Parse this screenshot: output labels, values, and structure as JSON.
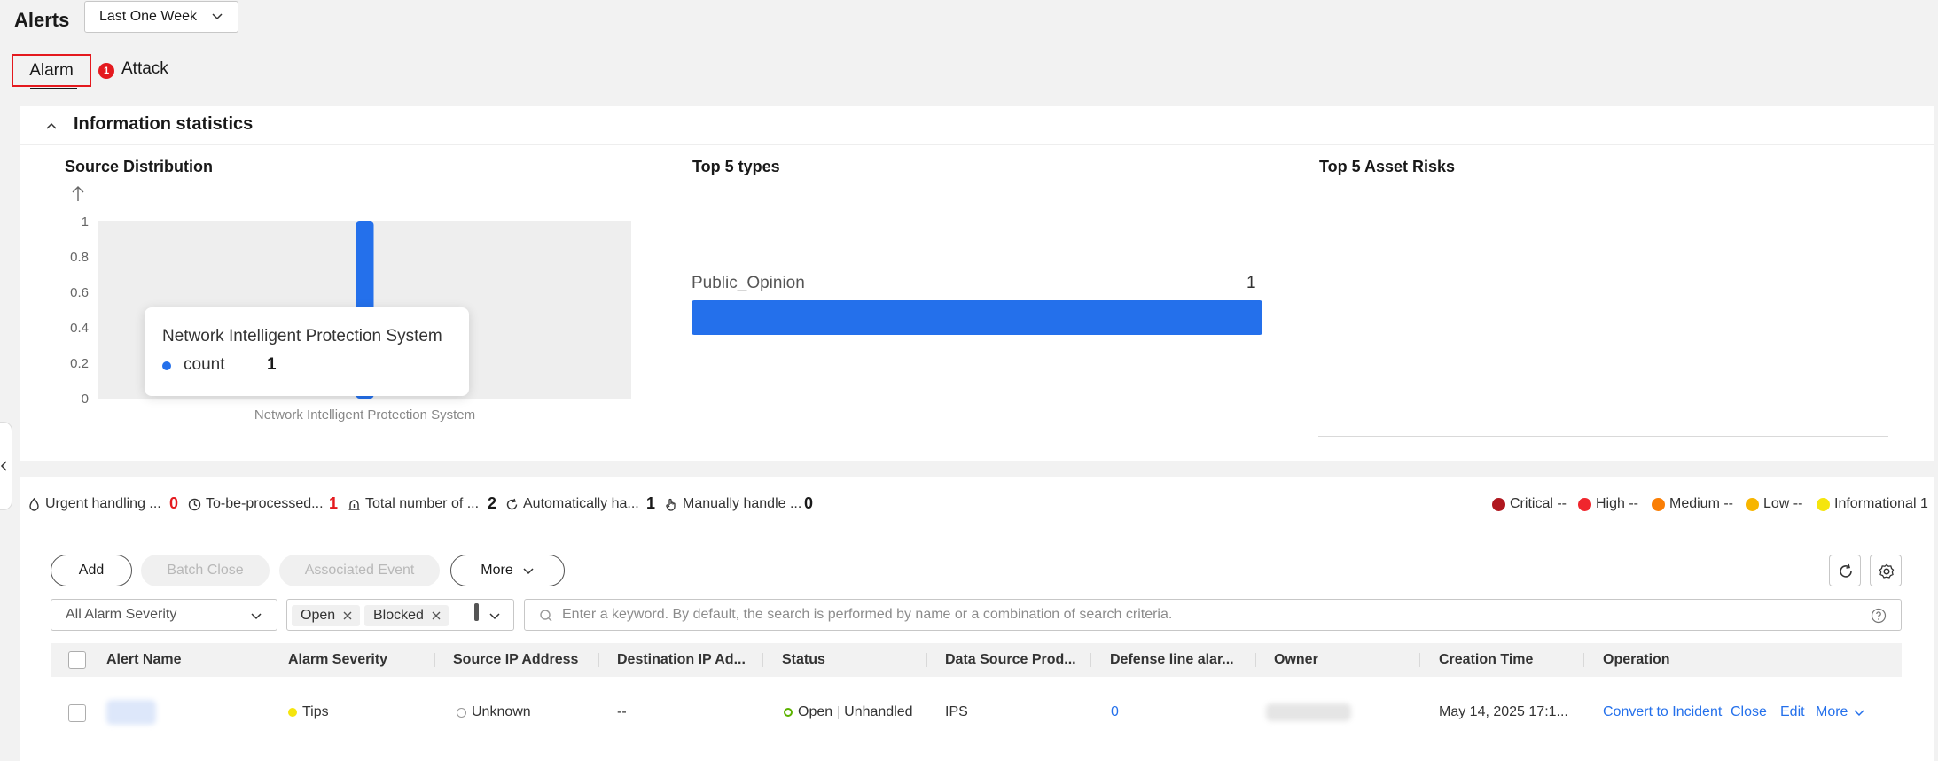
{
  "header": {
    "title": "Alerts",
    "time_range": "Last One Week"
  },
  "tabs": [
    {
      "label": "Alarm",
      "active": true
    },
    {
      "label": "Attack",
      "badge": "1"
    }
  ],
  "info_stats": {
    "title": "Information statistics",
    "source_distribution": {
      "title": "Source Distribution",
      "tooltip": {
        "title": "Network Intelligent Protection System",
        "series": "count",
        "value": "1"
      }
    },
    "top_types": {
      "title": "Top 5 types",
      "items": [
        {
          "label": "Public_Opinion",
          "value": "1"
        }
      ]
    },
    "top_assets": {
      "title": "Top 5 Asset Risks"
    }
  },
  "chart_data": {
    "type": "bar",
    "categories": [
      "Network Intelligent Protection System"
    ],
    "series": [
      {
        "name": "count",
        "values": [
          1
        ]
      }
    ],
    "ylim": [
      0,
      1
    ],
    "yticks": [
      "1",
      "0.8",
      "0.6",
      "0.4",
      "0.2",
      "0"
    ],
    "grid": false,
    "colors": {
      "bar": "#2470eb",
      "plot_bg": "#eeeeee"
    }
  },
  "summary": {
    "urgent": {
      "label": "Urgent handling ...",
      "value": "0",
      "icon": "urgent-icon"
    },
    "to_be_processed": {
      "label": "To-be-processed...",
      "value": "1",
      "icon": "clock-icon"
    },
    "total": {
      "label": "Total number of ...",
      "value": "2",
      "icon": "alarm-bell-icon"
    },
    "auto": {
      "label": "Automatically ha...",
      "value": "1",
      "icon": "refresh-icon"
    },
    "manual": {
      "label": "Manually handle ...",
      "value": "0",
      "icon": "hand-icon"
    }
  },
  "severity_legend": [
    {
      "label": "Critical --",
      "color": "#b0171f"
    },
    {
      "label": "High --",
      "color": "#f0262d"
    },
    {
      "label": "Medium --",
      "color": "#fa7e04"
    },
    {
      "label": "Low --",
      "color": "#f7b500"
    },
    {
      "label": "Informational 1",
      "color": "#f5e50d"
    }
  ],
  "toolbar": {
    "add": "Add",
    "batch_close": "Batch Close",
    "associated_event": "Associated Event",
    "more": "More"
  },
  "filters": {
    "severity": "All Alarm Severity",
    "status_chips": [
      "Open",
      "Blocked"
    ],
    "search_placeholder": "Enter a keyword. By default, the search is performed by name or a combination of search criteria."
  },
  "table": {
    "columns": [
      "Alert Name",
      "Alarm Severity",
      "Source IP Address",
      "Destination IP Ad...",
      "Status",
      "Data Source Prod...",
      "Defense line alar...",
      "Owner",
      "Creation Time",
      "Operation"
    ],
    "rows": [
      {
        "severity": "Tips",
        "source_ip": "Unknown",
        "dest_ip": "--",
        "status": "Open",
        "handling": "Unhandled",
        "data_source": "IPS",
        "defense_line": "0",
        "creation_time": "May 14, 2025 17:1...",
        "ops": [
          "Convert to Incident",
          "Close",
          "Edit",
          "More"
        ]
      }
    ]
  }
}
